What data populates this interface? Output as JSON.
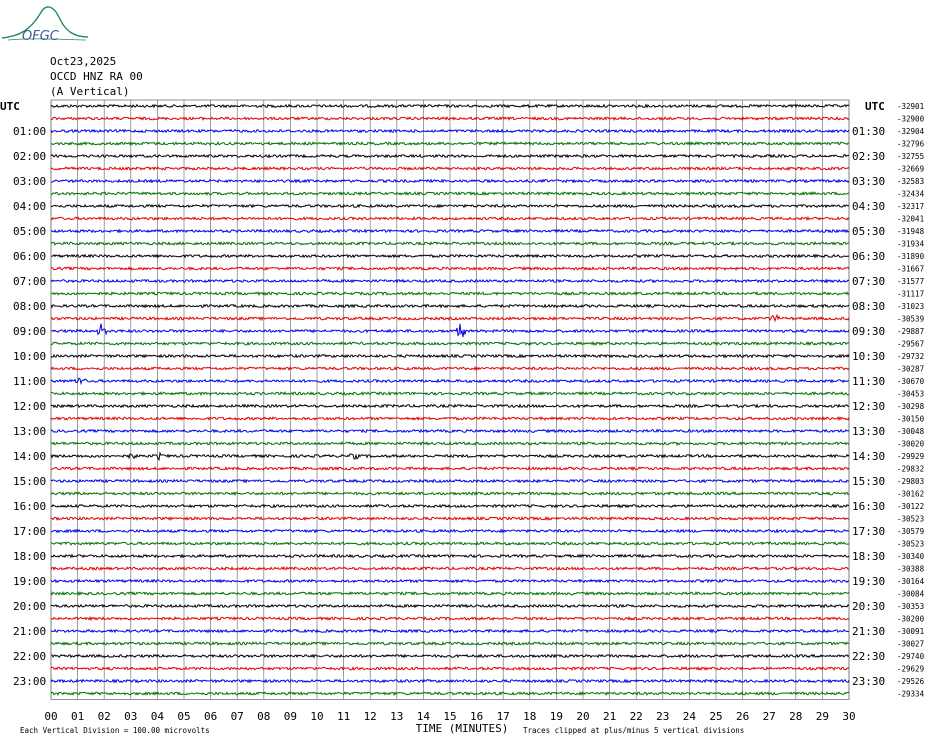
{
  "header": {
    "logo_text": "OFGC",
    "date": "Oct23,2025",
    "station": "OCCD HNZ RA 00",
    "component": "(A Vertical)"
  },
  "colors": {
    "trace_cycle": [
      "#000000",
      "#e00000",
      "#0000e0",
      "#007000"
    ],
    "grid": "#777777",
    "logo": "#2a8a5a"
  },
  "chart_data": {
    "type": "line",
    "title": "",
    "utc_label_left": "UTC",
    "utc_label_right": "UTC",
    "xlabel": "TIME (MINUTES)",
    "x_ticks": [
      "00",
      "01",
      "02",
      "03",
      "04",
      "05",
      "06",
      "07",
      "08",
      "09",
      "10",
      "11",
      "12",
      "13",
      "14",
      "15",
      "16",
      "17",
      "18",
      "19",
      "20",
      "21",
      "22",
      "23",
      "24",
      "25",
      "26",
      "27",
      "28",
      "29",
      "30"
    ],
    "xlim": [
      0,
      30
    ],
    "grid": true,
    "left_hour_labels": [
      "01:00",
      "02:00",
      "03:00",
      "04:00",
      "05:00",
      "06:00",
      "07:00",
      "08:00",
      "09:00",
      "10:00",
      "11:00",
      "12:00",
      "13:00",
      "14:00",
      "15:00",
      "16:00",
      "17:00",
      "18:00",
      "19:00",
      "20:00",
      "21:00",
      "22:00",
      "23:00"
    ],
    "right_hour_labels": [
      "01:30",
      "02:30",
      "03:30",
      "04:30",
      "05:30",
      "06:30",
      "07:30",
      "08:30",
      "09:30",
      "10:30",
      "11:30",
      "12:30",
      "13:30",
      "14:30",
      "15:30",
      "16:30",
      "17:30",
      "18:30",
      "19:30",
      "20:30",
      "21:30",
      "22:30",
      "23:30"
    ],
    "trace_offsets": [
      "-32901",
      "-32900",
      "-32904",
      "-32796",
      "-32755",
      "-32669",
      "-32583",
      "-32434",
      "-32317",
      "-32041",
      "-31948",
      "-31934",
      "-31890",
      "-31667",
      "-31577",
      "-31117",
      "-31023",
      "-30539",
      "-29887",
      "-29567",
      "-29732",
      "-30287",
      "-30670",
      "-30453",
      "-30298",
      "-30150",
      "-30048",
      "-30020",
      "-29929",
      "-29832",
      "-29803",
      "-30162",
      "-30122",
      "-30523",
      "-30579",
      "-30523",
      "-30340",
      "-30388",
      "-30164",
      "-30084",
      "-30353",
      "-30200",
      "-30091",
      "-30027",
      "-29740",
      "-29629",
      "-29526",
      "-29334"
    ],
    "events": [
      {
        "trace": 17,
        "minute": 27.2,
        "amplitude": 0.6
      },
      {
        "trace": 18,
        "minute": 1.9,
        "amplitude": 1.0
      },
      {
        "trace": 18,
        "minute": 15.4,
        "amplitude": 1.2
      },
      {
        "trace": 22,
        "minute": 1.1,
        "amplitude": 0.45
      },
      {
        "trace": 28,
        "minute": 3.0,
        "amplitude": 0.45
      },
      {
        "trace": 28,
        "minute": 4.0,
        "amplitude": 0.5
      },
      {
        "trace": 28,
        "minute": 11.4,
        "amplitude": 0.4
      }
    ],
    "footnote_left": "Each Vertical Division =  100.00 microvolts",
    "footnote_right": "Traces clipped at plus/minus 5 vertical divisions"
  }
}
